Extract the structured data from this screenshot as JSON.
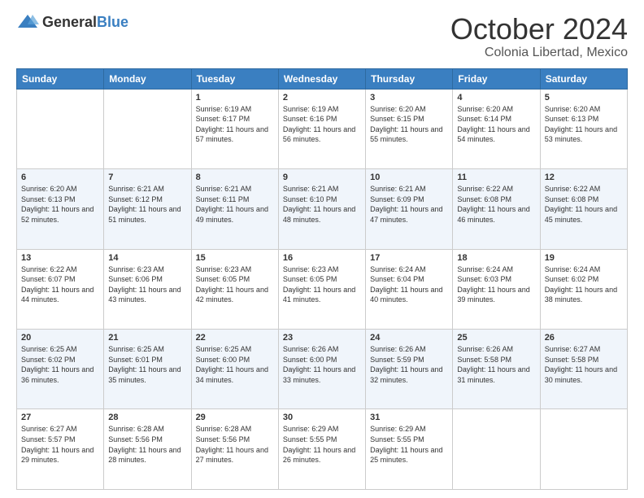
{
  "header": {
    "logo_general": "General",
    "logo_blue": "Blue",
    "month": "October 2024",
    "location": "Colonia Libertad, Mexico"
  },
  "days_of_week": [
    "Sunday",
    "Monday",
    "Tuesday",
    "Wednesday",
    "Thursday",
    "Friday",
    "Saturday"
  ],
  "weeks": [
    [
      {
        "day": "",
        "sunrise": "",
        "sunset": "",
        "daylight": ""
      },
      {
        "day": "",
        "sunrise": "",
        "sunset": "",
        "daylight": ""
      },
      {
        "day": "1",
        "sunrise": "Sunrise: 6:19 AM",
        "sunset": "Sunset: 6:17 PM",
        "daylight": "Daylight: 11 hours and 57 minutes."
      },
      {
        "day": "2",
        "sunrise": "Sunrise: 6:19 AM",
        "sunset": "Sunset: 6:16 PM",
        "daylight": "Daylight: 11 hours and 56 minutes."
      },
      {
        "day": "3",
        "sunrise": "Sunrise: 6:20 AM",
        "sunset": "Sunset: 6:15 PM",
        "daylight": "Daylight: 11 hours and 55 minutes."
      },
      {
        "day": "4",
        "sunrise": "Sunrise: 6:20 AM",
        "sunset": "Sunset: 6:14 PM",
        "daylight": "Daylight: 11 hours and 54 minutes."
      },
      {
        "day": "5",
        "sunrise": "Sunrise: 6:20 AM",
        "sunset": "Sunset: 6:13 PM",
        "daylight": "Daylight: 11 hours and 53 minutes."
      }
    ],
    [
      {
        "day": "6",
        "sunrise": "Sunrise: 6:20 AM",
        "sunset": "Sunset: 6:13 PM",
        "daylight": "Daylight: 11 hours and 52 minutes."
      },
      {
        "day": "7",
        "sunrise": "Sunrise: 6:21 AM",
        "sunset": "Sunset: 6:12 PM",
        "daylight": "Daylight: 11 hours and 51 minutes."
      },
      {
        "day": "8",
        "sunrise": "Sunrise: 6:21 AM",
        "sunset": "Sunset: 6:11 PM",
        "daylight": "Daylight: 11 hours and 49 minutes."
      },
      {
        "day": "9",
        "sunrise": "Sunrise: 6:21 AM",
        "sunset": "Sunset: 6:10 PM",
        "daylight": "Daylight: 11 hours and 48 minutes."
      },
      {
        "day": "10",
        "sunrise": "Sunrise: 6:21 AM",
        "sunset": "Sunset: 6:09 PM",
        "daylight": "Daylight: 11 hours and 47 minutes."
      },
      {
        "day": "11",
        "sunrise": "Sunrise: 6:22 AM",
        "sunset": "Sunset: 6:08 PM",
        "daylight": "Daylight: 11 hours and 46 minutes."
      },
      {
        "day": "12",
        "sunrise": "Sunrise: 6:22 AM",
        "sunset": "Sunset: 6:08 PM",
        "daylight": "Daylight: 11 hours and 45 minutes."
      }
    ],
    [
      {
        "day": "13",
        "sunrise": "Sunrise: 6:22 AM",
        "sunset": "Sunset: 6:07 PM",
        "daylight": "Daylight: 11 hours and 44 minutes."
      },
      {
        "day": "14",
        "sunrise": "Sunrise: 6:23 AM",
        "sunset": "Sunset: 6:06 PM",
        "daylight": "Daylight: 11 hours and 43 minutes."
      },
      {
        "day": "15",
        "sunrise": "Sunrise: 6:23 AM",
        "sunset": "Sunset: 6:05 PM",
        "daylight": "Daylight: 11 hours and 42 minutes."
      },
      {
        "day": "16",
        "sunrise": "Sunrise: 6:23 AM",
        "sunset": "Sunset: 6:05 PM",
        "daylight": "Daylight: 11 hours and 41 minutes."
      },
      {
        "day": "17",
        "sunrise": "Sunrise: 6:24 AM",
        "sunset": "Sunset: 6:04 PM",
        "daylight": "Daylight: 11 hours and 40 minutes."
      },
      {
        "day": "18",
        "sunrise": "Sunrise: 6:24 AM",
        "sunset": "Sunset: 6:03 PM",
        "daylight": "Daylight: 11 hours and 39 minutes."
      },
      {
        "day": "19",
        "sunrise": "Sunrise: 6:24 AM",
        "sunset": "Sunset: 6:02 PM",
        "daylight": "Daylight: 11 hours and 38 minutes."
      }
    ],
    [
      {
        "day": "20",
        "sunrise": "Sunrise: 6:25 AM",
        "sunset": "Sunset: 6:02 PM",
        "daylight": "Daylight: 11 hours and 36 minutes."
      },
      {
        "day": "21",
        "sunrise": "Sunrise: 6:25 AM",
        "sunset": "Sunset: 6:01 PM",
        "daylight": "Daylight: 11 hours and 35 minutes."
      },
      {
        "day": "22",
        "sunrise": "Sunrise: 6:25 AM",
        "sunset": "Sunset: 6:00 PM",
        "daylight": "Daylight: 11 hours and 34 minutes."
      },
      {
        "day": "23",
        "sunrise": "Sunrise: 6:26 AM",
        "sunset": "Sunset: 6:00 PM",
        "daylight": "Daylight: 11 hours and 33 minutes."
      },
      {
        "day": "24",
        "sunrise": "Sunrise: 6:26 AM",
        "sunset": "Sunset: 5:59 PM",
        "daylight": "Daylight: 11 hours and 32 minutes."
      },
      {
        "day": "25",
        "sunrise": "Sunrise: 6:26 AM",
        "sunset": "Sunset: 5:58 PM",
        "daylight": "Daylight: 11 hours and 31 minutes."
      },
      {
        "day": "26",
        "sunrise": "Sunrise: 6:27 AM",
        "sunset": "Sunset: 5:58 PM",
        "daylight": "Daylight: 11 hours and 30 minutes."
      }
    ],
    [
      {
        "day": "27",
        "sunrise": "Sunrise: 6:27 AM",
        "sunset": "Sunset: 5:57 PM",
        "daylight": "Daylight: 11 hours and 29 minutes."
      },
      {
        "day": "28",
        "sunrise": "Sunrise: 6:28 AM",
        "sunset": "Sunset: 5:56 PM",
        "daylight": "Daylight: 11 hours and 28 minutes."
      },
      {
        "day": "29",
        "sunrise": "Sunrise: 6:28 AM",
        "sunset": "Sunset: 5:56 PM",
        "daylight": "Daylight: 11 hours and 27 minutes."
      },
      {
        "day": "30",
        "sunrise": "Sunrise: 6:29 AM",
        "sunset": "Sunset: 5:55 PM",
        "daylight": "Daylight: 11 hours and 26 minutes."
      },
      {
        "day": "31",
        "sunrise": "Sunrise: 6:29 AM",
        "sunset": "Sunset: 5:55 PM",
        "daylight": "Daylight: 11 hours and 25 minutes."
      },
      {
        "day": "",
        "sunrise": "",
        "sunset": "",
        "daylight": ""
      },
      {
        "day": "",
        "sunrise": "",
        "sunset": "",
        "daylight": ""
      }
    ]
  ]
}
